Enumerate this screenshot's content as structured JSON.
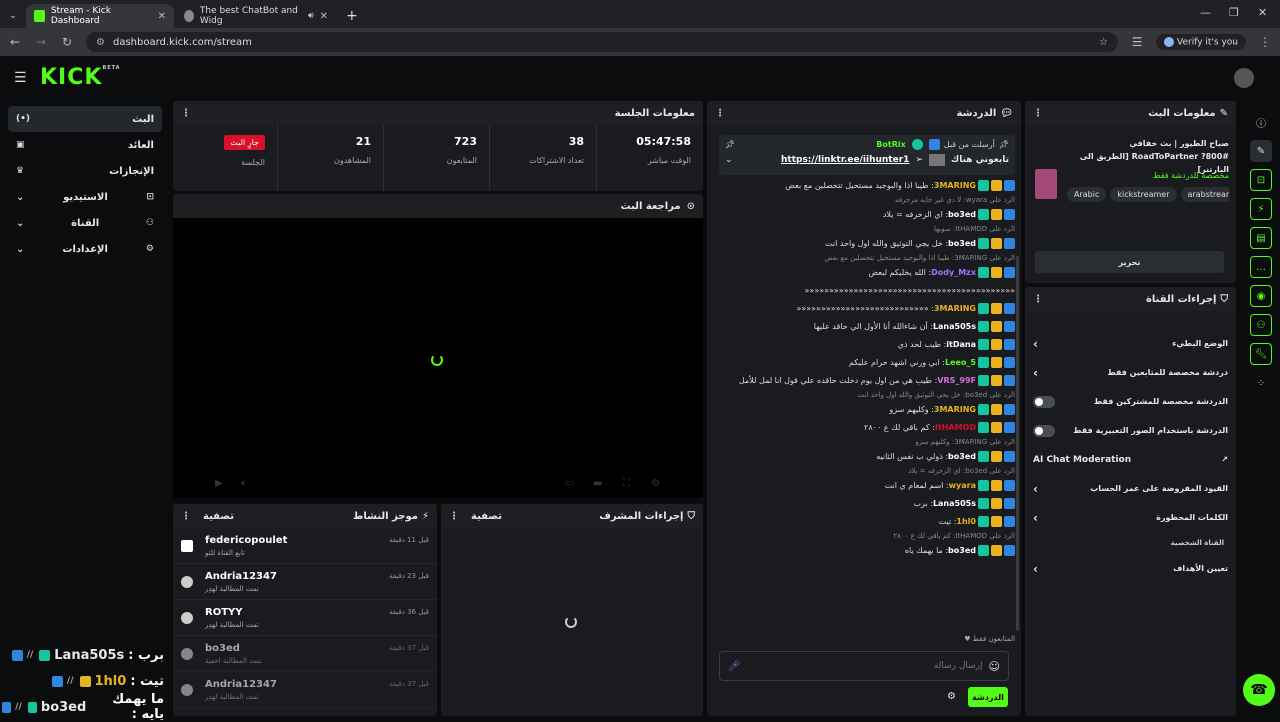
{
  "browser": {
    "tabs": [
      {
        "title": "Stream - Kick Dashboard",
        "active": true
      },
      {
        "title": "The best ChatBot and Widg",
        "active": false
      }
    ],
    "url": "dashboard.kick.com/stream",
    "profile_label": "Verify it's you"
  },
  "app": {
    "logo": "KICK",
    "logo_sup": "BETA"
  },
  "leftnav": [
    {
      "label": "البث",
      "icon": "broadcast-icon",
      "active": true
    },
    {
      "label": "العائد",
      "icon": "revenue-icon"
    },
    {
      "label": "الإنجازات",
      "icon": "trophy-icon"
    },
    {
      "label": "الاستيديو",
      "icon": "studio-icon"
    },
    {
      "label": "القناة",
      "icon": "channel-icon"
    },
    {
      "label": "الإعدادات",
      "icon": "gear-icon"
    }
  ],
  "session": {
    "title": "معلومات الجلسة",
    "stats": [
      {
        "value": "جارٍ البث",
        "label": "الجلسة"
      },
      {
        "value": "21",
        "label": "المشاهدون"
      },
      {
        "value": "723",
        "label": "المتابعون"
      },
      {
        "value": "38",
        "label": "تعداد الاشتراكات"
      },
      {
        "value": "05:47:58",
        "label": "الوقت مباشر"
      }
    ]
  },
  "preview": {
    "title": "مراجعة البث"
  },
  "activity": {
    "title": "موجز النشاط",
    "filter": "تصفية",
    "items": [
      {
        "name": "federicopoulet",
        "sub": "تابع القناة للتو",
        "time": "قبل 11 دقيقة"
      },
      {
        "name": "Andria12347",
        "sub": "تمت المطالبة لهدِر",
        "time": "قبل 23 دقيقة"
      },
      {
        "name": "ROTYY",
        "sub": "تمت المطالبة لهدِر",
        "time": "قبل 36 دقيقة"
      },
      {
        "name": "bo3ed",
        "sub": "تمت المطالبة اخفية",
        "time": "قبل 37 دقيقة"
      },
      {
        "name": "Andria12347",
        "sub": "تمت المطالبة لهدِر",
        "time": "قبل 37 دقيقة"
      }
    ]
  },
  "mod": {
    "title": "إجراءات المشرف",
    "filter": "تصفية"
  },
  "chat": {
    "title": "الدردشة",
    "pinned": {
      "by": "أرسلت من قبل",
      "user": "BotRix",
      "text": "تابعوني هناك",
      "link": "https://linktr.ee/iihunter1"
    },
    "messages": [
      {
        "reply": "",
        "user": "3MARING",
        "color": "#e8b323",
        "text": "طيبا اذا والبوجيد مستحيل تتحصلين مع بعض"
      },
      {
        "reply": "الرد على wyara: لا دي غير جايه مزخرفه",
        "user": "bo3ed",
        "color": "#ffffff",
        "text": "اي الزخرفه = يلاد"
      },
      {
        "reply": "الرد على ItHAMOD: سويها",
        "user": "bo3ed",
        "color": "#ffffff",
        "text": "خل يجي التوثيق والله اول واحد انت"
      },
      {
        "reply": "الرد على 3MARING: طيبا اذا والبوجيد مستحيل تتحصلين مع بعض",
        "user": "Dody_Mzx",
        "color": "#a970ff",
        "text": "الله يخليكم لبعض"
      },
      {
        "reply": "",
        "user": "",
        "color": "#ffffff",
        "text": "«««««««««««««««««««««««««««««««««««««««««««"
      },
      {
        "reply": "",
        "user": "3MARING",
        "color": "#e8b323",
        "text": "«««««««««««««««««««««««««««"
      },
      {
        "reply": "",
        "user": "Lana505s",
        "color": "#ffffff",
        "text": "أن شاءالله أنا الأول الي حاقد عليها"
      },
      {
        "reply": "",
        "user": "itDana",
        "color": "#ffffff",
        "text": "طيب لحد ذي"
      },
      {
        "reply": "",
        "user": "Leeo_5",
        "color": "#53fc18",
        "text": "ابي ورني اشهد حرام عليكم"
      },
      {
        "reply": "",
        "user": "VRS_99F",
        "color": "#e06ae0",
        "text": "طيب هي من اول يوم دخلت حاقده علي قول انا لمل للأمل"
      },
      {
        "reply": "الرد على bo3ed: خل يجي التوثيق والله اول واحد انت",
        "user": "3MARING",
        "color": "#e8b323",
        "text": "وكليهم سزو"
      },
      {
        "reply": "",
        "user": "ItHAMOD",
        "color": "#d9102a",
        "text": "كم باقي لك ع ٢٨٠٠"
      },
      {
        "reply": "الرد على 3MARING: وكليهم سزو",
        "user": "bo3ed",
        "color": "#ffffff",
        "text": "ذولي ب نفس الثانيه"
      },
      {
        "reply": "الرد على bo3ed: اي الزخرفه = يلاد",
        "user": "wyara",
        "color": "#e8b323",
        "text": "اسم لمعام ي انت"
      },
      {
        "reply": "",
        "user": "Lana505s",
        "color": "#ffffff",
        "text": "برب"
      },
      {
        "reply": "",
        "user": "1hl0",
        "color": "#e8b323",
        "text": "تيت"
      },
      {
        "reply": "الرد على ItHAMOD: كم باقي لك ع ٢٨٠٠",
        "user": "bo3ed",
        "color": "#ffffff",
        "text": "ما يهمك ياه"
      }
    ],
    "followers_only": "المتابعون فقط",
    "input_placeholder": "إرسال رسالة",
    "send_label": "الدردشة"
  },
  "stream_info": {
    "title": "معلومات البث",
    "stream_title": "صباح الطيور | بث خفافي #RoadToPartner ?800 [الطريق الى البارتنر]",
    "category": "مخصصة للدردشة فقط",
    "tags": [
      "Arabic",
      "kickstreamer",
      "arabstreame"
    ],
    "edit_label": "تحرير"
  },
  "channel_actions": {
    "title": "إجراءات القناة",
    "rows": [
      {
        "label": "الوضع البطيء",
        "type": "chevron"
      },
      {
        "label": "دردشة مخصصة للمتابعين فقط",
        "type": "chevron"
      },
      {
        "label": "الدردشة مخصصة للمشتركين فقط",
        "type": "toggle"
      },
      {
        "label": "الدردشة باستخدام الصور التعبيرية فقط",
        "type": "toggle"
      },
      {
        "label": "AI Chat Moderation",
        "type": "external"
      },
      {
        "label": "القيود المفروضة على عمر الحساب",
        "type": "chevron"
      },
      {
        "label": "الكلمات المحظورة",
        "type": "chevron"
      },
      {
        "label": "القناة الشخصية",
        "type": "header"
      },
      {
        "label": "تعيين الأهداف",
        "type": "chevron"
      }
    ]
  },
  "overlay": [
    {
      "user": "Lana505s",
      "text": "برب :"
    },
    {
      "user": "1hl0",
      "text": "تيت :"
    },
    {
      "user": "bo3ed",
      "text": "ما يهمك يايه :"
    }
  ],
  "colors": {
    "accent": "#53fc18",
    "live": "#d9102a"
  }
}
